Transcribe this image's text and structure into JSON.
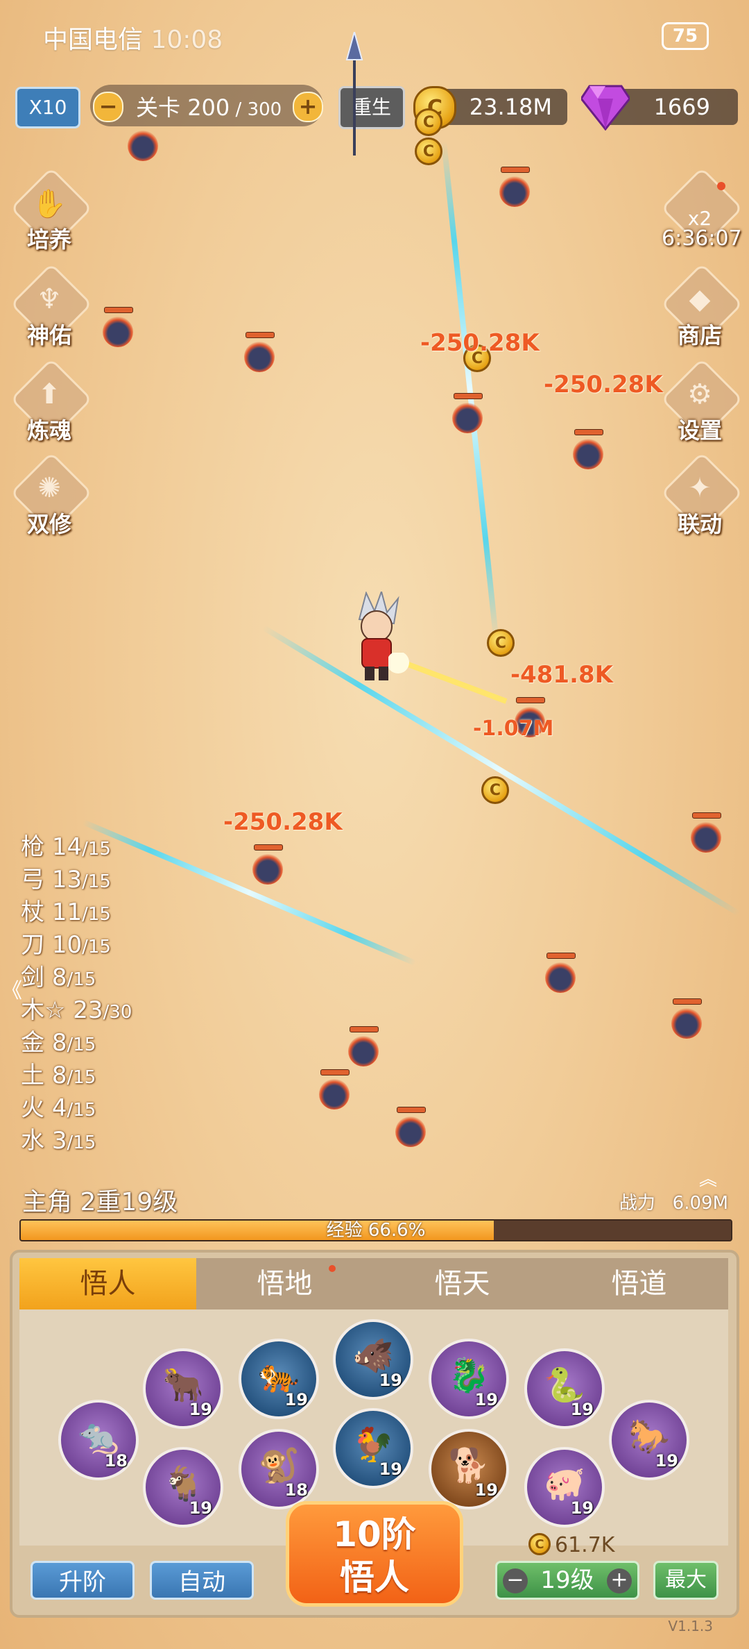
{
  "status": {
    "carrier": "中国电信",
    "time": "10:08",
    "battery": "75"
  },
  "topbar": {
    "multiplier": "X10",
    "level_label": "关卡",
    "level_current": "200",
    "level_sep": " / ",
    "level_total": "300",
    "minus": "−",
    "plus": "+",
    "rebirth": "重生",
    "gold": "23.18M",
    "gems": "1669"
  },
  "left_menu": [
    {
      "label": "培养",
      "icon": "hand-icon"
    },
    {
      "label": "神佑",
      "icon": "blessing-icon"
    },
    {
      "label": "炼魂",
      "icon": "soul-icon"
    },
    {
      "label": "双修",
      "icon": "dual-icon"
    }
  ],
  "right_menu": {
    "bonus_label": "x2",
    "bonus_timer": "6:36:07",
    "shop": "商店",
    "settings": "设置",
    "collab": "联动"
  },
  "damage_numbers": [
    "-250.28K",
    "-250.28K",
    "-481.8K",
    "-1.07M",
    "-250.28K"
  ],
  "weapons": [
    {
      "name": "枪",
      "value": "14",
      "max": "/15"
    },
    {
      "name": "弓",
      "value": "13",
      "max": "/15"
    },
    {
      "name": "杖",
      "value": "11",
      "max": "/15"
    },
    {
      "name": "刀",
      "value": "10",
      "max": "/15"
    },
    {
      "name": "剑",
      "value": "8",
      "max": "/15"
    },
    {
      "name": "木☆",
      "value": "23",
      "max": "/30"
    },
    {
      "name": "金",
      "value": "8",
      "max": "/15"
    },
    {
      "name": "土",
      "value": "8",
      "max": "/15"
    },
    {
      "name": "火",
      "value": "4",
      "max": "/15"
    },
    {
      "name": "水",
      "value": "3",
      "max": "/15"
    }
  ],
  "hero": {
    "title": "主角 2重19级",
    "power_label": "战力",
    "power": "6.09M",
    "exp_label": "经验 66.6%",
    "exp_fraction": 0.666
  },
  "tabs": [
    "悟人",
    "悟地",
    "悟天",
    "悟道"
  ],
  "zodiac": [
    {
      "animal": "🐀",
      "level": "18",
      "color": "purple"
    },
    {
      "animal": "🐂",
      "level": "19",
      "color": "purple"
    },
    {
      "animal": "🐐",
      "level": "19",
      "color": "purple"
    },
    {
      "animal": "🐅",
      "level": "19",
      "color": "blue"
    },
    {
      "animal": "🐒",
      "level": "18",
      "color": "purple"
    },
    {
      "animal": "🐗",
      "level": "19",
      "color": "blue"
    },
    {
      "animal": "🐓",
      "level": "19",
      "color": "blue"
    },
    {
      "animal": "🐉",
      "level": "19",
      "color": "purple"
    },
    {
      "animal": "🐕",
      "level": "19",
      "color": "orange"
    },
    {
      "animal": "🐍",
      "level": "19",
      "color": "purple"
    },
    {
      "animal": "🐖",
      "level": "19",
      "color": "purple"
    },
    {
      "animal": "🐎",
      "level": "19",
      "color": "purple"
    }
  ],
  "actions": {
    "upgrade": "升阶",
    "auto": "自动",
    "big_line1": "10阶",
    "big_line2": "悟人",
    "cost": "61.7K",
    "stepper_level": "19级",
    "max": "最大",
    "version": "V1.1.3",
    "coin_glyph": "C",
    "collapse": "《",
    "expand": "︽"
  }
}
